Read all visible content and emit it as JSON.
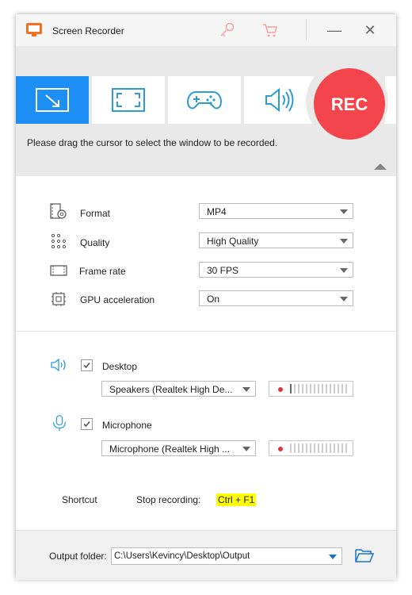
{
  "window": {
    "title": "Screen Recorder"
  },
  "titlebar": {
    "icons": [
      "key-icon",
      "cart-icon"
    ],
    "controls": [
      "minimize",
      "close"
    ]
  },
  "mode_tabs": [
    {
      "name": "region",
      "icon": "region-select-icon",
      "active": true
    },
    {
      "name": "fullscreen",
      "icon": "fullscreen-icon",
      "active": false
    },
    {
      "name": "game",
      "icon": "gamepad-icon",
      "active": false
    },
    {
      "name": "audio",
      "icon": "speaker-icon",
      "active": false
    }
  ],
  "rec_button": {
    "label": "REC",
    "color": "#f4454c"
  },
  "hint": "Please drag the cursor to select the window to be recorded.",
  "settings": {
    "format": {
      "label": "Format",
      "value": "MP4"
    },
    "quality": {
      "label": "Quality",
      "value": "High Quality"
    },
    "frame_rate": {
      "label": "Frame rate",
      "value": "30 FPS"
    },
    "gpu": {
      "label": "GPU acceleration",
      "value": "On"
    }
  },
  "audio": {
    "desktop": {
      "label": "Desktop",
      "checked": true,
      "device": "Speakers (Realtek High De..."
    },
    "microphone": {
      "label": "Microphone",
      "checked": true,
      "device": "Microphone (Realtek High ..."
    }
  },
  "shortcut": {
    "label": "Shortcut",
    "action": "Stop recording:",
    "keys": "Ctrl + F1"
  },
  "output": {
    "label": "Output folder:",
    "path": "C:\\Users\\Kevincy\\Desktop\\Output"
  },
  "colors": {
    "accent": "#1e8ff5",
    "rec": "#f4454c",
    "icon_blue": "#2c9bd6"
  }
}
